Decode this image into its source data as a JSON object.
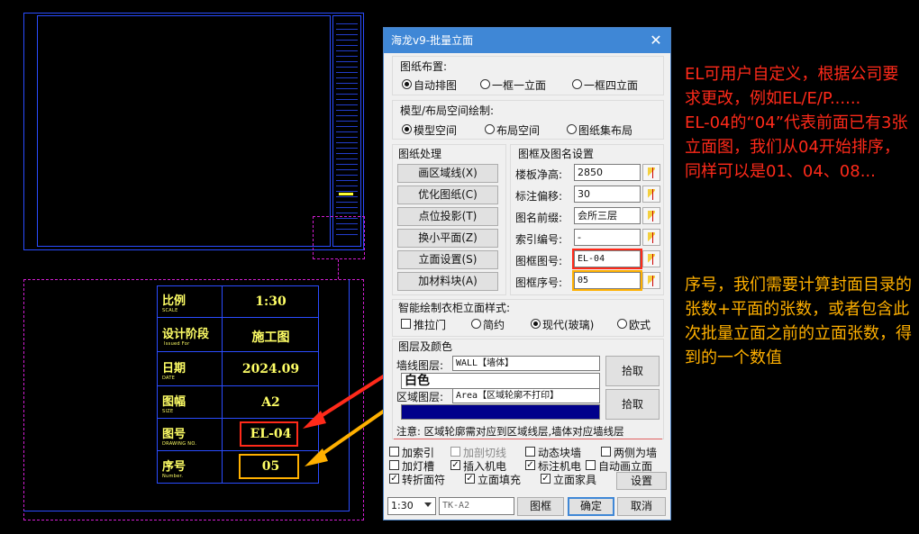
{
  "cad": {
    "title_block": [
      {
        "label": "比例",
        "sub": "SCALE",
        "value": "1:30"
      },
      {
        "label": "设计阶段",
        "sub": "Issued For",
        "value": "施工图"
      },
      {
        "label": "日期",
        "sub": "DATE",
        "value": "2024.09"
      },
      {
        "label": "图幅",
        "sub": "SIZE",
        "value": "A2"
      },
      {
        "label": "图号",
        "sub": "DRAWING NO.",
        "value": "EL-04"
      },
      {
        "label": "序号",
        "sub": "Number.",
        "value": "05"
      }
    ]
  },
  "dialog": {
    "title": "海龙v9-批量立面",
    "layout_group": {
      "title": "图纸布置:",
      "options": [
        "自动排图",
        "一框一立面",
        "一框四立面"
      ],
      "selected": 0
    },
    "space_group": {
      "title": "模型/布局空间绘制:",
      "options": [
        "模型空间",
        "布局空间",
        "图纸集布局"
      ],
      "selected": 0
    },
    "process_group": {
      "title": "图纸处理",
      "buttons": [
        "画区域线(X)",
        "优化图纸(C)",
        "点位投影(T)",
        "换小平面(Z)",
        "立面设置(S)",
        "加材料块(A)"
      ]
    },
    "frame_group": {
      "title": "图框及图名设置",
      "fields": [
        {
          "label": "楼板净高:",
          "value": "2850"
        },
        {
          "label": "标注偏移:",
          "value": "30"
        },
        {
          "label": "图名前缀:",
          "value": "会所三层"
        },
        {
          "label": "索引编号:",
          "value": "-"
        },
        {
          "label": "图框图号:",
          "value": "EL-04"
        },
        {
          "label": "图框序号:",
          "value": "05"
        }
      ]
    },
    "style_group": {
      "title": "智能绘制衣柜立面样式:",
      "check_label": "推拉门",
      "options": [
        "简约",
        "现代(玻璃)",
        "欧式"
      ],
      "selected": 1
    },
    "layer_group": {
      "title": "图层及颜色",
      "wall_label": "墙线图层:",
      "wall_value": "WALL【墙体】",
      "wall_color": "白色",
      "area_label": "区域图层:",
      "area_value": "Area【区域轮廓不打印】",
      "pick1": "拾取",
      "pick2": "拾取",
      "note": "注意: 区域轮廓需对应到区域线层,墙体对应墙线层"
    },
    "checkboxes": [
      {
        "label": "加索引",
        "checked": false
      },
      {
        "label": "加剖切线",
        "checked": false,
        "disabled": true
      },
      {
        "label": "动态块墙",
        "checked": false
      },
      {
        "label": "两侧为墙",
        "checked": false
      },
      {
        "label": "加灯槽",
        "checked": false
      },
      {
        "label": "插入机电",
        "checked": true
      },
      {
        "label": "标注机电",
        "checked": true
      },
      {
        "label": "自动画立面",
        "checked": false
      },
      {
        "label": "转折面符",
        "checked": true
      },
      {
        "label": "立面填充",
        "checked": true
      },
      {
        "label": "立面家具",
        "checked": true
      }
    ],
    "settings_button": "设置",
    "footer": {
      "scale": "1:30",
      "frame_name": "TK-A2",
      "frame_button": "图框",
      "ok_button": "确定",
      "cancel_button": "取消"
    }
  },
  "annotations": {
    "red_text": "EL可用户自定义，根据公司要求更改，例如EL/E/P......\nEL-04的“04”代表前面已有3张立面图，我们从04开始排序，同样可以是01、04、08...",
    "orange_text": "序号，我们需要计算封面目录的张数+平面的张数，或者包含此次批量立面之前的立面张数，得到的一个数值",
    "red_color": "#ff2a1a",
    "orange_color": "#ffb000"
  }
}
